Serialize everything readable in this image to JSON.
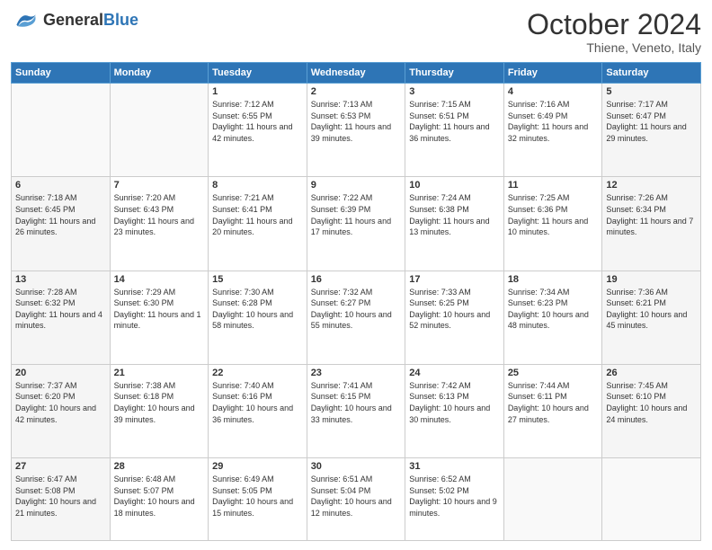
{
  "header": {
    "logo_general": "General",
    "logo_blue": "Blue",
    "month": "October 2024",
    "location": "Thiene, Veneto, Italy"
  },
  "days_of_week": [
    "Sunday",
    "Monday",
    "Tuesday",
    "Wednesday",
    "Thursday",
    "Friday",
    "Saturday"
  ],
  "weeks": [
    [
      {
        "day": "",
        "info": ""
      },
      {
        "day": "",
        "info": ""
      },
      {
        "day": "1",
        "sunrise": "Sunrise: 7:12 AM",
        "sunset": "Sunset: 6:55 PM",
        "daylight": "Daylight: 11 hours and 42 minutes."
      },
      {
        "day": "2",
        "sunrise": "Sunrise: 7:13 AM",
        "sunset": "Sunset: 6:53 PM",
        "daylight": "Daylight: 11 hours and 39 minutes."
      },
      {
        "day": "3",
        "sunrise": "Sunrise: 7:15 AM",
        "sunset": "Sunset: 6:51 PM",
        "daylight": "Daylight: 11 hours and 36 minutes."
      },
      {
        "day": "4",
        "sunrise": "Sunrise: 7:16 AM",
        "sunset": "Sunset: 6:49 PM",
        "daylight": "Daylight: 11 hours and 32 minutes."
      },
      {
        "day": "5",
        "sunrise": "Sunrise: 7:17 AM",
        "sunset": "Sunset: 6:47 PM",
        "daylight": "Daylight: 11 hours and 29 minutes."
      }
    ],
    [
      {
        "day": "6",
        "sunrise": "Sunrise: 7:18 AM",
        "sunset": "Sunset: 6:45 PM",
        "daylight": "Daylight: 11 hours and 26 minutes."
      },
      {
        "day": "7",
        "sunrise": "Sunrise: 7:20 AM",
        "sunset": "Sunset: 6:43 PM",
        "daylight": "Daylight: 11 hours and 23 minutes."
      },
      {
        "day": "8",
        "sunrise": "Sunrise: 7:21 AM",
        "sunset": "Sunset: 6:41 PM",
        "daylight": "Daylight: 11 hours and 20 minutes."
      },
      {
        "day": "9",
        "sunrise": "Sunrise: 7:22 AM",
        "sunset": "Sunset: 6:39 PM",
        "daylight": "Daylight: 11 hours and 17 minutes."
      },
      {
        "day": "10",
        "sunrise": "Sunrise: 7:24 AM",
        "sunset": "Sunset: 6:38 PM",
        "daylight": "Daylight: 11 hours and 13 minutes."
      },
      {
        "day": "11",
        "sunrise": "Sunrise: 7:25 AM",
        "sunset": "Sunset: 6:36 PM",
        "daylight": "Daylight: 11 hours and 10 minutes."
      },
      {
        "day": "12",
        "sunrise": "Sunrise: 7:26 AM",
        "sunset": "Sunset: 6:34 PM",
        "daylight": "Daylight: 11 hours and 7 minutes."
      }
    ],
    [
      {
        "day": "13",
        "sunrise": "Sunrise: 7:28 AM",
        "sunset": "Sunset: 6:32 PM",
        "daylight": "Daylight: 11 hours and 4 minutes."
      },
      {
        "day": "14",
        "sunrise": "Sunrise: 7:29 AM",
        "sunset": "Sunset: 6:30 PM",
        "daylight": "Daylight: 11 hours and 1 minute."
      },
      {
        "day": "15",
        "sunrise": "Sunrise: 7:30 AM",
        "sunset": "Sunset: 6:28 PM",
        "daylight": "Daylight: 10 hours and 58 minutes."
      },
      {
        "day": "16",
        "sunrise": "Sunrise: 7:32 AM",
        "sunset": "Sunset: 6:27 PM",
        "daylight": "Daylight: 10 hours and 55 minutes."
      },
      {
        "day": "17",
        "sunrise": "Sunrise: 7:33 AM",
        "sunset": "Sunset: 6:25 PM",
        "daylight": "Daylight: 10 hours and 52 minutes."
      },
      {
        "day": "18",
        "sunrise": "Sunrise: 7:34 AM",
        "sunset": "Sunset: 6:23 PM",
        "daylight": "Daylight: 10 hours and 48 minutes."
      },
      {
        "day": "19",
        "sunrise": "Sunrise: 7:36 AM",
        "sunset": "Sunset: 6:21 PM",
        "daylight": "Daylight: 10 hours and 45 minutes."
      }
    ],
    [
      {
        "day": "20",
        "sunrise": "Sunrise: 7:37 AM",
        "sunset": "Sunset: 6:20 PM",
        "daylight": "Daylight: 10 hours and 42 minutes."
      },
      {
        "day": "21",
        "sunrise": "Sunrise: 7:38 AM",
        "sunset": "Sunset: 6:18 PM",
        "daylight": "Daylight: 10 hours and 39 minutes."
      },
      {
        "day": "22",
        "sunrise": "Sunrise: 7:40 AM",
        "sunset": "Sunset: 6:16 PM",
        "daylight": "Daylight: 10 hours and 36 minutes."
      },
      {
        "day": "23",
        "sunrise": "Sunrise: 7:41 AM",
        "sunset": "Sunset: 6:15 PM",
        "daylight": "Daylight: 10 hours and 33 minutes."
      },
      {
        "day": "24",
        "sunrise": "Sunrise: 7:42 AM",
        "sunset": "Sunset: 6:13 PM",
        "daylight": "Daylight: 10 hours and 30 minutes."
      },
      {
        "day": "25",
        "sunrise": "Sunrise: 7:44 AM",
        "sunset": "Sunset: 6:11 PM",
        "daylight": "Daylight: 10 hours and 27 minutes."
      },
      {
        "day": "26",
        "sunrise": "Sunrise: 7:45 AM",
        "sunset": "Sunset: 6:10 PM",
        "daylight": "Daylight: 10 hours and 24 minutes."
      }
    ],
    [
      {
        "day": "27",
        "sunrise": "Sunrise: 6:47 AM",
        "sunset": "Sunset: 5:08 PM",
        "daylight": "Daylight: 10 hours and 21 minutes."
      },
      {
        "day": "28",
        "sunrise": "Sunrise: 6:48 AM",
        "sunset": "Sunset: 5:07 PM",
        "daylight": "Daylight: 10 hours and 18 minutes."
      },
      {
        "day": "29",
        "sunrise": "Sunrise: 6:49 AM",
        "sunset": "Sunset: 5:05 PM",
        "daylight": "Daylight: 10 hours and 15 minutes."
      },
      {
        "day": "30",
        "sunrise": "Sunrise: 6:51 AM",
        "sunset": "Sunset: 5:04 PM",
        "daylight": "Daylight: 10 hours and 12 minutes."
      },
      {
        "day": "31",
        "sunrise": "Sunrise: 6:52 AM",
        "sunset": "Sunset: 5:02 PM",
        "daylight": "Daylight: 10 hours and 9 minutes."
      },
      {
        "day": "",
        "info": ""
      },
      {
        "day": "",
        "info": ""
      }
    ]
  ]
}
